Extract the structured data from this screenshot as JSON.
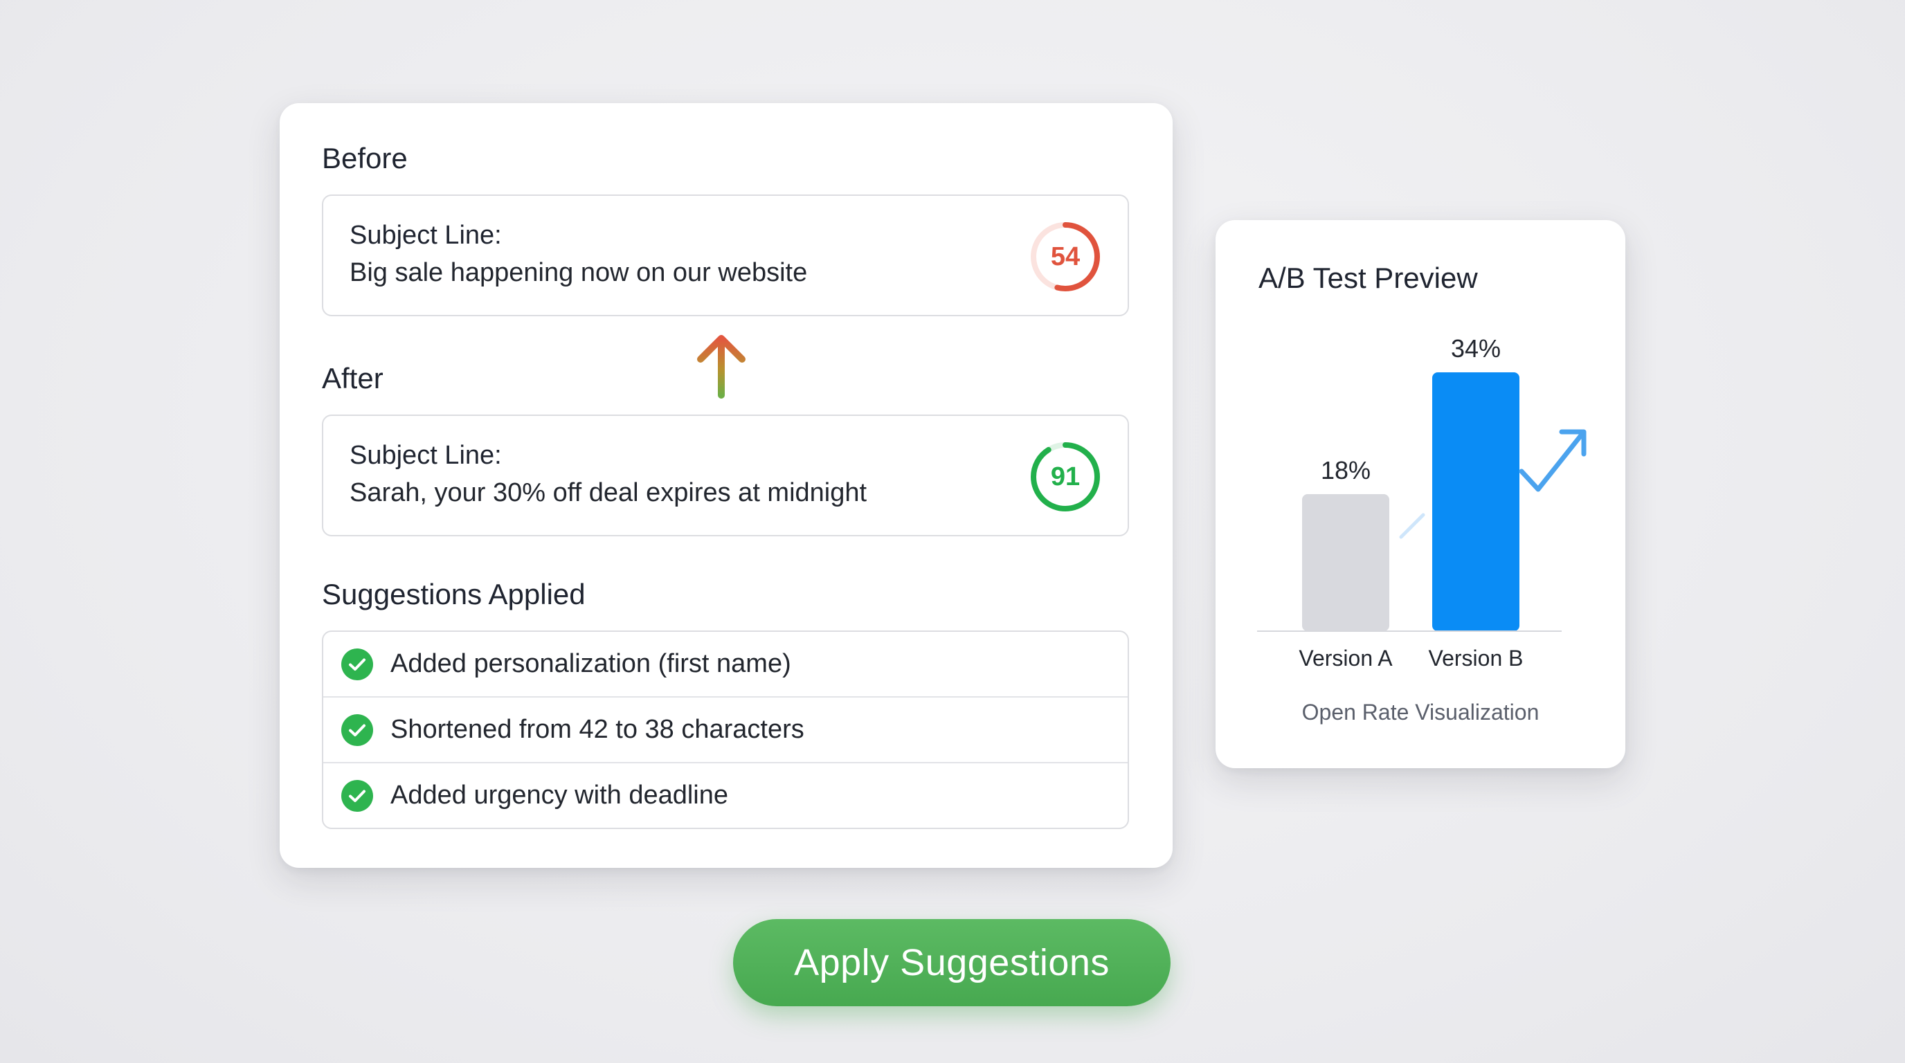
{
  "before": {
    "heading": "Before",
    "subject_label": "Subject Line:",
    "subject_text": "Big sale happening now on our website",
    "score": 54,
    "score_color": "#e0533d"
  },
  "after": {
    "heading": "After",
    "subject_label": "Subject Line:",
    "subject_text": "Sarah, your 30% off deal expires at midnight",
    "score": 91,
    "score_color": "#22b04b"
  },
  "suggestions": {
    "heading": "Suggestions Applied",
    "items": [
      "Added personalization (first name)",
      "Shortened from 42 to 38 characters",
      "Added urgency with deadline"
    ],
    "check_color": "#2eb44f"
  },
  "ab_test": {
    "title": "A/B Test Preview",
    "caption": "Open Rate Visualization",
    "chart_data": {
      "type": "bar",
      "categories": [
        "Version A",
        "Version B"
      ],
      "values": [
        18,
        34
      ],
      "value_labels": [
        "18%",
        "34%"
      ],
      "colors": [
        "#d8d9de",
        "#0a8cf5"
      ],
      "ylim": [
        0,
        40
      ],
      "xlabel": "",
      "ylabel": "",
      "grid": false
    }
  },
  "apply_button": {
    "label": "Apply Suggestions"
  },
  "colors": {
    "accent_green": "#47a950",
    "accent_blue": "#0a8cf5",
    "warn_red": "#e0533d"
  }
}
